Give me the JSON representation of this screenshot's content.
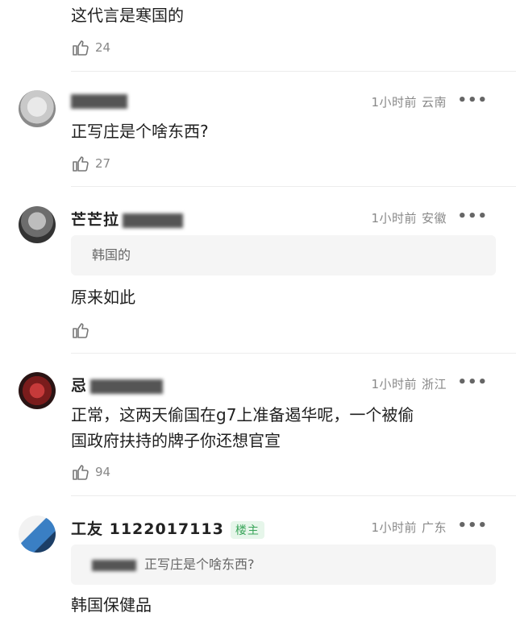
{
  "comments": [
    {
      "text": "这代言是寒国的",
      "likes": "24"
    },
    {
      "meta": {
        "time": "1小时前",
        "location": "云南"
      },
      "text": "正写庄是个啥东西?",
      "likes": "27",
      "more": "•••"
    },
    {
      "user": "芒芒拉",
      "meta": {
        "time": "1小时前",
        "location": "安徽"
      },
      "quote": "韩国的",
      "text": "原来如此",
      "likes": "",
      "more": "•••"
    },
    {
      "user": "忌",
      "meta": {
        "time": "1小时前",
        "location": "浙江"
      },
      "text_line1": "正常，这两天偷国在g7上准备遏华呢，一个被偷",
      "text_line2": "国政府扶持的牌子你还想官宣",
      "likes": "94",
      "more": "•••"
    },
    {
      "user": "工友 1122017113",
      "badge": "楼主",
      "meta": {
        "time": "1小时前",
        "location": "广东"
      },
      "quote": "正写庄是个啥东西?",
      "text": "韩国保健品",
      "more": "•••"
    }
  ],
  "icons": {
    "like": "thumbs-up-icon",
    "more": "more-dots-icon"
  },
  "colors": {
    "badge_bg": "#e6f6ea",
    "badge_text": "#3aa55a",
    "meta": "#888888"
  }
}
